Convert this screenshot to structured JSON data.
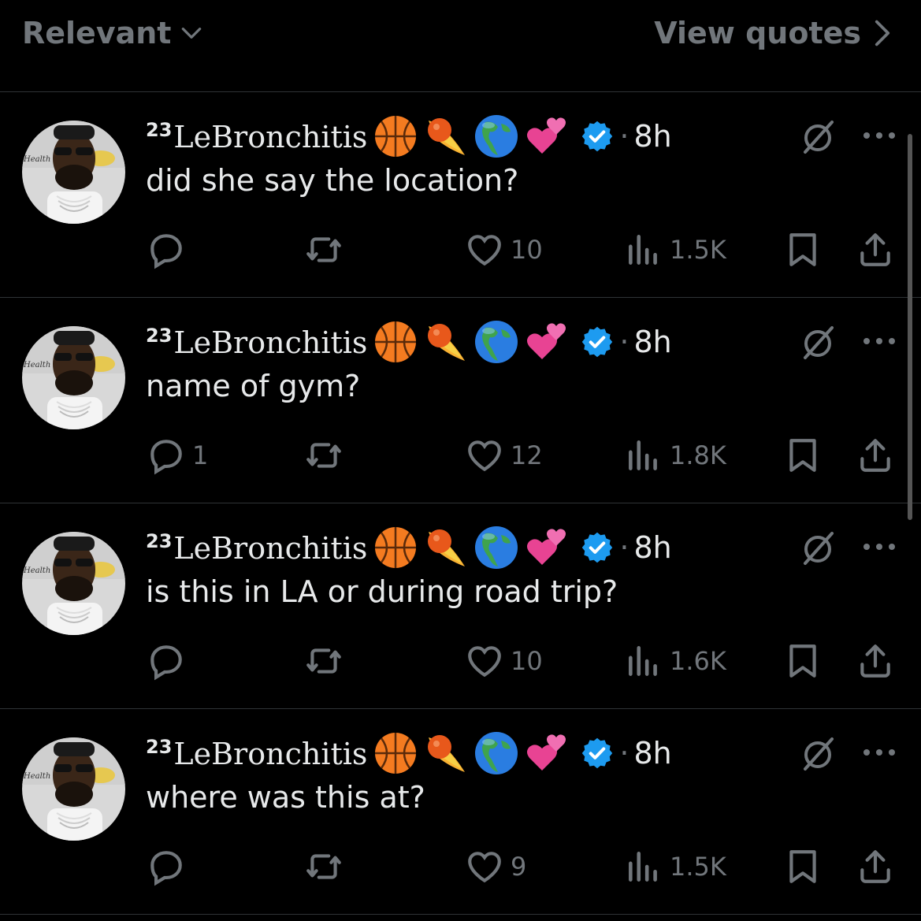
{
  "topbar": {
    "sort_label": "Relevant",
    "view_quotes_label": "View quotes"
  },
  "tweets": [
    {
      "name": "LeBronchitis",
      "name_prefix": "23",
      "emojis": [
        "basketball",
        "fire-ball",
        "earth-globe-americas",
        "two-hearts"
      ],
      "time": "8h",
      "text": "did she say the location?",
      "replies": "",
      "retweets": "",
      "likes": "10",
      "views": "1.5K"
    },
    {
      "name": "LeBronchitis",
      "name_prefix": "23",
      "emojis": [
        "basketball",
        "fire-ball",
        "earth-globe-americas",
        "two-hearts"
      ],
      "time": "8h",
      "text": "name of gym?",
      "replies": "1",
      "retweets": "",
      "likes": "12",
      "views": "1.8K"
    },
    {
      "name": "LeBronchitis",
      "name_prefix": "23",
      "emojis": [
        "basketball",
        "fire-ball",
        "earth-globe-americas",
        "two-hearts"
      ],
      "time": "8h",
      "text": "is this in LA or during road trip?",
      "replies": "",
      "retweets": "",
      "likes": "10",
      "views": "1.6K"
    },
    {
      "name": "LeBronchitis",
      "name_prefix": "23",
      "emojis": [
        "basketball",
        "fire-ball",
        "earth-globe-americas",
        "two-hearts"
      ],
      "time": "8h",
      "text": "where was this at?",
      "replies": "",
      "retweets": "",
      "likes": "9",
      "views": "1.5K"
    }
  ],
  "colors": {
    "background": "#000000",
    "text": "#e7e9ea",
    "muted": "#71767b",
    "verified": "#1d9bf0",
    "divider": "#2f3336"
  }
}
